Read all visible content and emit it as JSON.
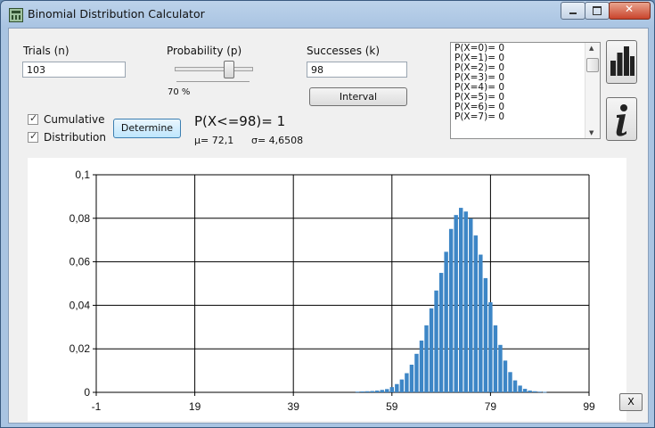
{
  "window": {
    "title": "Binomial Distribution Calculator"
  },
  "trials": {
    "label": "Trials (n)",
    "value": "103"
  },
  "probability": {
    "label": "Probability (p)",
    "display": "70 %",
    "slider_value": 0.7
  },
  "successes": {
    "label": "Successes (k)",
    "value": "98"
  },
  "interval_button": "Interval",
  "cumulative_label": "Cumulative",
  "distribution_label": "Distribution",
  "determine_button": "Determine",
  "result": {
    "expression": "P(X<=98)= 1",
    "mu": "μ= 72,1",
    "sigma": "σ= 4,6508"
  },
  "list_items": [
    "P(X=0)= 0",
    "P(X=1)= 0",
    "P(X=2)= 0",
    "P(X=3)= 0",
    "P(X=4)= 0",
    "P(X=5)= 0",
    "P(X=6)= 0",
    "P(X=7)= 0"
  ],
  "icons": {
    "chart": "bar-chart-icon",
    "info": "info-icon"
  },
  "close_chart_button": "X",
  "colors": {
    "bar": "#3d86c6",
    "grid": "#000000"
  },
  "chart_data": {
    "type": "bar",
    "x_ticks": [
      "-1",
      "19",
      "39",
      "59",
      "79",
      "99"
    ],
    "y_ticks": [
      "0",
      "0,02",
      "0,04",
      "0,06",
      "0,08",
      "0,1"
    ],
    "xlim": [
      -1,
      99
    ],
    "ylim": [
      0,
      0.1
    ],
    "grid": true,
    "x": [
      52,
      53,
      54,
      55,
      56,
      57,
      58,
      59,
      60,
      61,
      62,
      63,
      64,
      65,
      66,
      67,
      68,
      69,
      70,
      71,
      72,
      73,
      74,
      75,
      76,
      77,
      78,
      79,
      80,
      81,
      82,
      83,
      84,
      85,
      86,
      87,
      88,
      89,
      90
    ],
    "values": [
      0.0003,
      0.0004,
      0.0005,
      0.0006,
      0.0008,
      0.0011,
      0.0015,
      0.0024,
      0.0038,
      0.0059,
      0.0088,
      0.0127,
      0.0177,
      0.0238,
      0.0308,
      0.0386,
      0.0468,
      0.0549,
      0.0646,
      0.0751,
      0.0815,
      0.0848,
      0.0831,
      0.0799,
      0.0721,
      0.0633,
      0.0525,
      0.0414,
      0.0308,
      0.0218,
      0.0146,
      0.0093,
      0.0055,
      0.0031,
      0.0016,
      0.0008,
      0.0005,
      0.0003,
      0.0002
    ]
  }
}
